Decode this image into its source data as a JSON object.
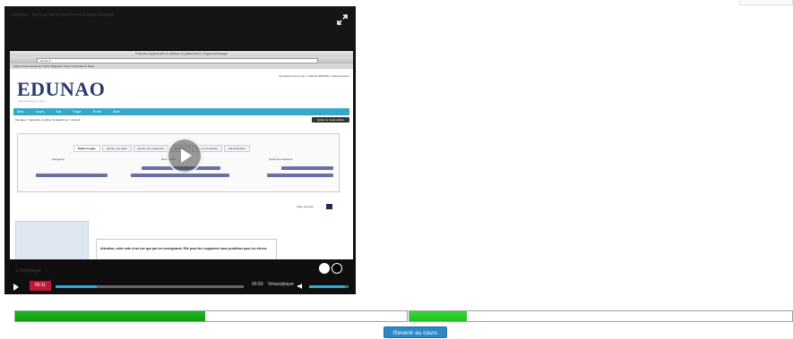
{
  "video": {
    "title": "Edunao - 1er pas sur la plateforme d'apprentissage",
    "quality_label": "1 Play/player",
    "elapsed": "00:11",
    "duration": "00:50",
    "vimeo_label": "Vimeo/player",
    "progress_fraction": 0.22,
    "volume_fraction": 0.92,
    "icons": [
      "fullscreen-icon",
      "play-icon",
      "volume-icon"
    ],
    "accent_color": "#2ab0d8",
    "elapsed_color": "#c0173a"
  },
  "screen": {
    "mac_title": "Edunao Apprendre à utiliser la plateforme d'apprentissage",
    "url": "edunao.fr",
    "bookmarks": "Apple  iCloud  Facebook  Twitter  Wikipedia  Yahoo!  Informations  News",
    "logo": "EDUNAO",
    "logo_sub": "Apprentissage en ligne",
    "login_line": "Connecté sous le nom « Maxime MARTIN » (Déconnexion)",
    "nav": "Mes cours  Ma Page  Profil  Aide",
    "crumb": "Ma page > Apprendre à utiliser la plateforme > Accueil",
    "edit_button": "Quitter le mode édition",
    "tabs": [
      "Éditer la page",
      "Ajouter une page",
      "Ajouter une ressource",
      "Nouveau",
      "Editer une activité",
      "Administration"
    ],
    "sections": [
      "Navigation",
      "Ressources",
      "Outils des étudiants"
    ],
    "page_label": "Page suivante",
    "bold_text": "Attention, cette note n'est vue que par les enseignants. Elle peut être supprimée sans problème pour les élèves."
  },
  "progress_bars": [
    {
      "fill": 0.485,
      "bright": false
    },
    {
      "fill": 0.15,
      "bright": true
    }
  ],
  "course_button": {
    "label": "Revenir au cours",
    "color": "#2d88c8"
  }
}
